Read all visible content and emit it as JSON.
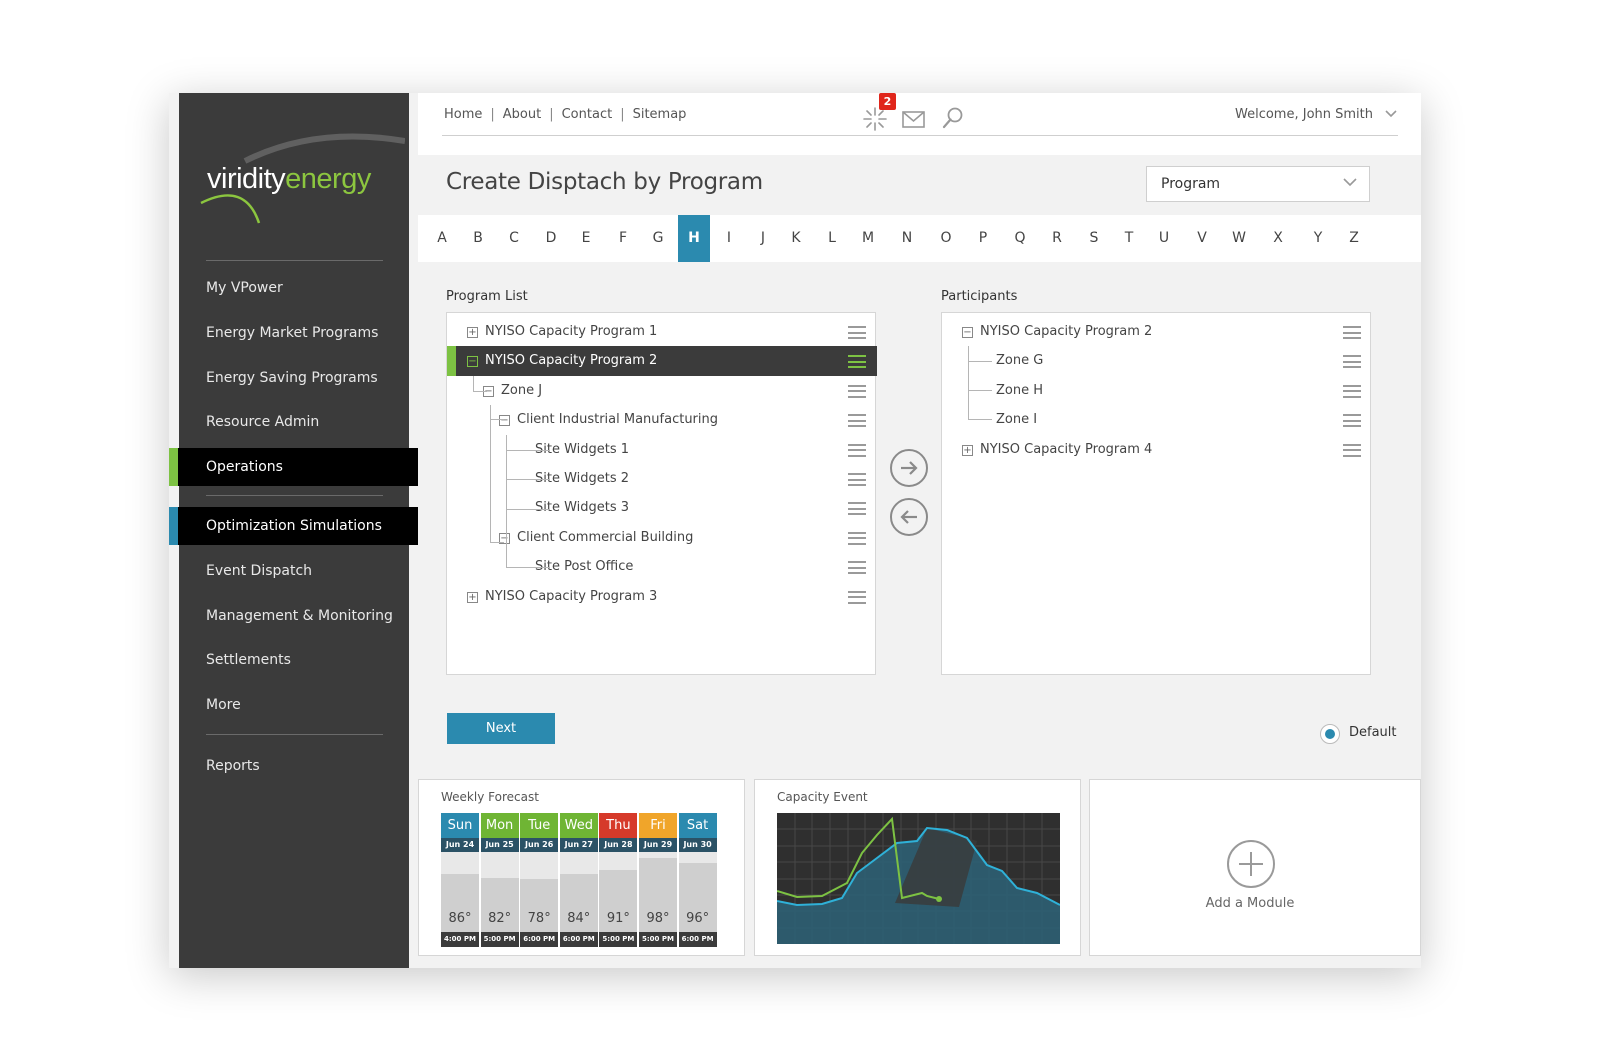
{
  "logo": {
    "part1": "viridity",
    "part2": "energy"
  },
  "sidebar": {
    "items": [
      {
        "label": "My VPower"
      },
      {
        "label": "Energy Market Programs"
      },
      {
        "label": "Energy Saving Programs"
      },
      {
        "label": "Resource Admin"
      },
      {
        "label": "Operations"
      },
      {
        "label": "Optimization Simulations"
      },
      {
        "label": "Event Dispatch"
      },
      {
        "label": "Management & Monitoring"
      },
      {
        "label": "Settlements"
      },
      {
        "label": "More"
      },
      {
        "label": "Reports"
      }
    ]
  },
  "topnav": {
    "links": [
      "Home",
      "About",
      "Contact",
      "Sitemap"
    ],
    "separator": "|",
    "notification_count": "2",
    "welcome": "Welcome, John Smith",
    "icons": [
      "alert-burst-icon",
      "mail-icon",
      "search-icon",
      "chevron-down-icon"
    ]
  },
  "page": {
    "title": "Create Disptach by Program",
    "select_value": "Program"
  },
  "alphabet": {
    "letters": [
      "A",
      "B",
      "C",
      "D",
      "E",
      "F",
      "G",
      "H",
      "I",
      "J",
      "K",
      "L",
      "M",
      "N",
      "O",
      "P",
      "Q",
      "R",
      "S",
      "T",
      "U",
      "V",
      "W",
      "X",
      "Y",
      "Z"
    ],
    "active": "H"
  },
  "program_list": {
    "label": "Program List",
    "rows": [
      {
        "text": "NYISO Capacity Program 1",
        "toggle": "+"
      },
      {
        "text": "NYISO Capacity Program 2",
        "toggle": "−"
      },
      {
        "text": "Zone J",
        "toggle": "−"
      },
      {
        "text": "Client Industrial Manufacturing",
        "toggle": "−"
      },
      {
        "text": "Site Widgets 1"
      },
      {
        "text": "Site Widgets 2"
      },
      {
        "text": "Site Widgets 3"
      },
      {
        "text": "Client Commercial Building",
        "toggle": "−"
      },
      {
        "text": "Site Post Office"
      },
      {
        "text": "NYISO Capacity Program 3",
        "toggle": "+"
      }
    ]
  },
  "participants": {
    "label": "Participants",
    "rows": [
      {
        "text": "NYISO Capacity Program 2",
        "toggle": "−"
      },
      {
        "text": "Zone G"
      },
      {
        "text": "Zone H"
      },
      {
        "text": "Zone I"
      },
      {
        "text": "NYISO Capacity Program 4",
        "toggle": "+"
      }
    ]
  },
  "actions": {
    "next": "Next",
    "default_label": "Default"
  },
  "modules": {
    "weekly": {
      "title": "Weekly Forecast",
      "days": [
        {
          "day": "Sun",
          "date": "Jun 24",
          "temp": "86°",
          "time": "4:00 PM",
          "color": "#2b8aaf",
          "level": 0.72
        },
        {
          "day": "Mon",
          "date": "Jun 25",
          "temp": "82°",
          "time": "5:00 PM",
          "color": "#6fb534",
          "level": 0.68
        },
        {
          "day": "Tue",
          "date": "Jun 26",
          "temp": "78°",
          "time": "6:00 PM",
          "color": "#6fb534",
          "level": 0.66
        },
        {
          "day": "Wed",
          "date": "Jun 27",
          "temp": "84°",
          "time": "6:00 PM",
          "color": "#6fb534",
          "level": 0.72
        },
        {
          "day": "Thu",
          "date": "Jun 28",
          "temp": "91°",
          "time": "5:00 PM",
          "color": "#d63a2a",
          "level": 0.78
        },
        {
          "day": "Fri",
          "date": "Jun 29",
          "temp": "98°",
          "time": "5:00 PM",
          "color": "#f0a52a",
          "level": 0.92
        },
        {
          "day": "Sat",
          "date": "Jun 30",
          "temp": "96°",
          "time": "6:00 PM",
          "color": "#2b8aaf",
          "level": 0.86
        }
      ]
    },
    "capacity": {
      "title": "Capacity Event"
    },
    "add": {
      "label": "Add a Module"
    }
  }
}
